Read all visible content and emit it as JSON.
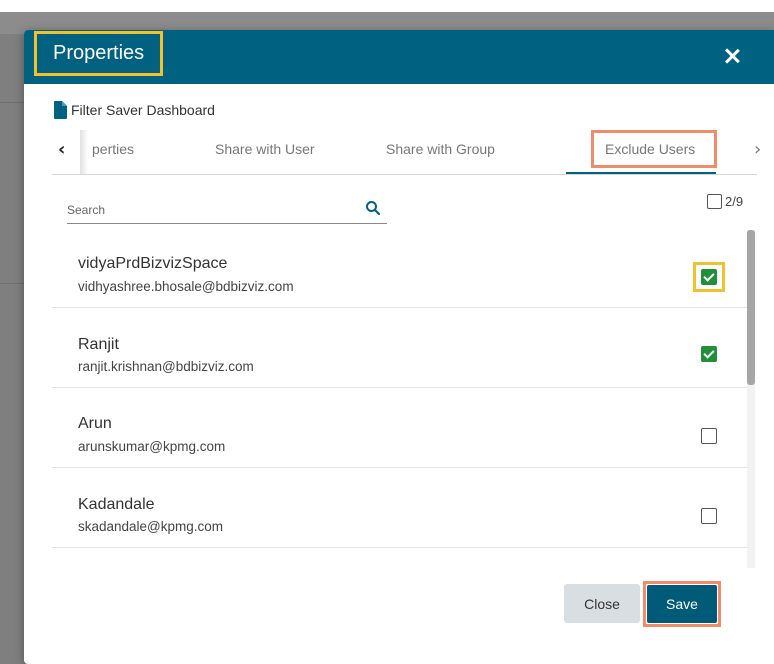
{
  "dialog": {
    "title": "Properties",
    "header_color": "#006280",
    "document_name": "Filter Saver Dashboard"
  },
  "tabs": [
    {
      "label": "perties"
    },
    {
      "label": "Share with User"
    },
    {
      "label": "Share with Group"
    },
    {
      "label": "Exclude Users",
      "active": true
    }
  ],
  "search": {
    "placeholder": "Search",
    "value": ""
  },
  "selection": {
    "count_label": "2/9"
  },
  "users": [
    {
      "name": "vidyaPrdBizvizSpace",
      "email": "vidhyashree.bhosale@bdbizviz.com",
      "checked": true
    },
    {
      "name": "Ranjit",
      "email": "ranjit.krishnan@bdbizviz.com",
      "checked": true
    },
    {
      "name": "Arun",
      "email": "arunskumar@kpmg.com",
      "checked": false
    },
    {
      "name": "Kadandale",
      "email": "skadandale@kpmg.com",
      "checked": false
    }
  ],
  "footer": {
    "close_label": "Close",
    "save_label": "Save"
  },
  "colors": {
    "accent": "#006280",
    "checkbox_checked": "#1f8f3a",
    "highlight_yellow": "#f2c12e",
    "highlight_orange": "#ef8c6a"
  }
}
